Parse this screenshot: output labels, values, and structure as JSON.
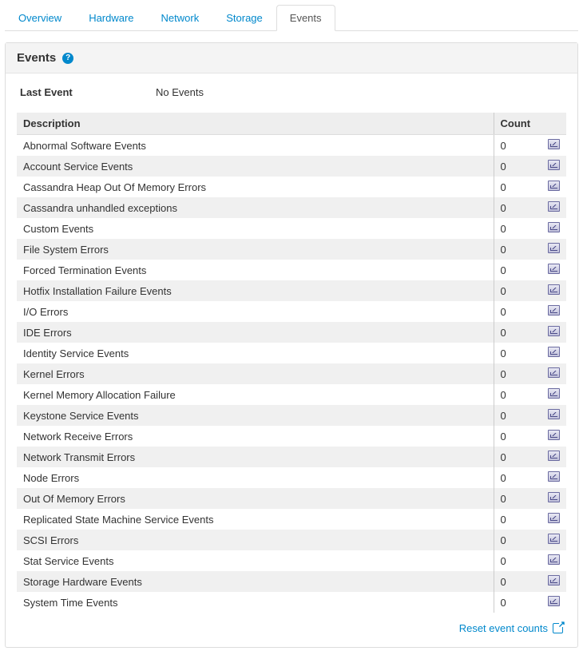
{
  "tabs": [
    {
      "label": "Overview",
      "active": false
    },
    {
      "label": "Hardware",
      "active": false
    },
    {
      "label": "Network",
      "active": false
    },
    {
      "label": "Storage",
      "active": false
    },
    {
      "label": "Events",
      "active": true
    }
  ],
  "panel": {
    "title": "Events",
    "last_event_label": "Last Event",
    "last_event_value": "No Events",
    "columns": {
      "description": "Description",
      "count": "Count"
    },
    "rows": [
      {
        "description": "Abnormal Software Events",
        "count": "0"
      },
      {
        "description": "Account Service Events",
        "count": "0"
      },
      {
        "description": "Cassandra Heap Out Of Memory Errors",
        "count": "0"
      },
      {
        "description": "Cassandra unhandled exceptions",
        "count": "0"
      },
      {
        "description": "Custom Events",
        "count": "0"
      },
      {
        "description": "File System Errors",
        "count": "0"
      },
      {
        "description": "Forced Termination Events",
        "count": "0"
      },
      {
        "description": "Hotfix Installation Failure Events",
        "count": "0"
      },
      {
        "description": "I/O Errors",
        "count": "0"
      },
      {
        "description": "IDE Errors",
        "count": "0"
      },
      {
        "description": "Identity Service Events",
        "count": "0"
      },
      {
        "description": "Kernel Errors",
        "count": "0"
      },
      {
        "description": "Kernel Memory Allocation Failure",
        "count": "0"
      },
      {
        "description": "Keystone Service Events",
        "count": "0"
      },
      {
        "description": "Network Receive Errors",
        "count": "0"
      },
      {
        "description": "Network Transmit Errors",
        "count": "0"
      },
      {
        "description": "Node Errors",
        "count": "0"
      },
      {
        "description": "Out Of Memory Errors",
        "count": "0"
      },
      {
        "description": "Replicated State Machine Service Events",
        "count": "0"
      },
      {
        "description": "SCSI Errors",
        "count": "0"
      },
      {
        "description": "Stat Service Events",
        "count": "0"
      },
      {
        "description": "Storage Hardware Events",
        "count": "0"
      },
      {
        "description": "System Time Events",
        "count": "0"
      }
    ],
    "reset_label": "Reset event counts"
  }
}
